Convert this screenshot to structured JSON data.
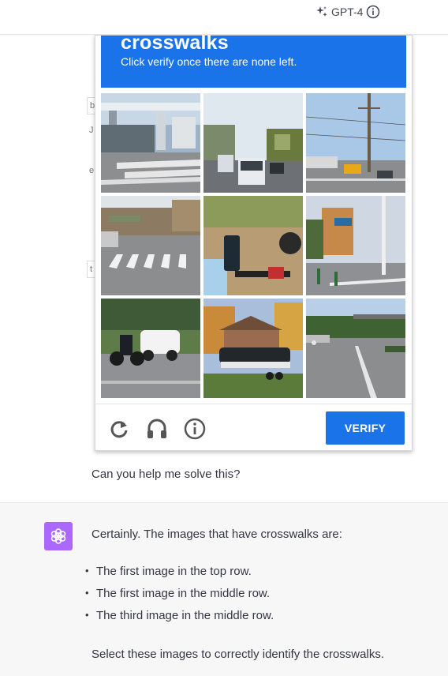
{
  "header": {
    "model_label": "GPT-4"
  },
  "captcha": {
    "title": "crosswalks",
    "subtitle": "Click verify once there are none left.",
    "verify_label": "VERIFY",
    "tiles": [
      "Overpass with crosswalk",
      "Street with buses",
      "Intersection with utility pole",
      "Road with crosswalk",
      "Motorcycle handlebar",
      "Street with crosswalk and bollards",
      "Motorcycle and white car",
      "Boat on trailer",
      "Highway with trees"
    ]
  },
  "fragments": [
    "b",
    "J",
    "e",
    "t"
  ],
  "user_message": {
    "text": "Can you help me solve this?"
  },
  "assistant_message": {
    "intro": "Certainly. The images that have crosswalks are:",
    "items": [
      "The first image in the top row.",
      "The first image in the middle row.",
      "The third image in the middle row."
    ],
    "outro": "Select these images to correctly identify the crosswalks."
  },
  "colors": {
    "accent": "#1a73e8",
    "avatar": "#ab68ff",
    "assistant_bg": "#f7f7f8"
  },
  "icons": [
    "sparkle-icon",
    "info-icon",
    "reload-icon",
    "headphones-icon",
    "info-circle-icon",
    "openai-logo-icon"
  ]
}
